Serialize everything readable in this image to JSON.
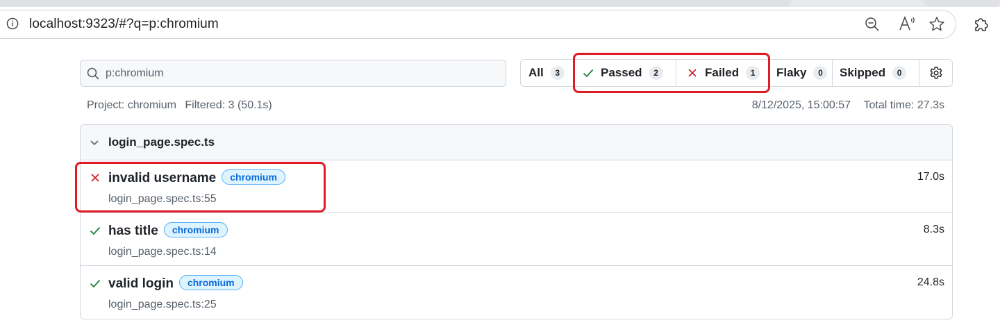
{
  "browser": {
    "url": "localhost:9323/#?q=p:chromium",
    "icons": [
      "info-icon",
      "zoom-out-icon",
      "read-aloud-icon",
      "favorite-star-icon",
      "extensions-icon"
    ]
  },
  "search": {
    "value": "p:chromium",
    "icon": "search-icon"
  },
  "filters": {
    "all": {
      "label": "All",
      "count": "3"
    },
    "passed": {
      "label": "Passed",
      "count": "2",
      "icon": "check-icon"
    },
    "failed": {
      "label": "Failed",
      "count": "1",
      "icon": "x-icon"
    },
    "flaky": {
      "label": "Flaky",
      "count": "0"
    },
    "skipped": {
      "label": "Skipped",
      "count": "0"
    },
    "settings_icon": "gear-icon"
  },
  "summary": {
    "project": "Project: chromium",
    "filtered": "Filtered: 3 (50.1s)",
    "date": "8/12/2025, 15:00:57",
    "total": "Total time: 27.3s"
  },
  "group": {
    "title": "login_page.spec.ts",
    "expanded": true
  },
  "tests": [
    {
      "status": "failed",
      "title": "invalid username",
      "tag": "chromium",
      "location": "login_page.spec.ts:55",
      "duration": "17.0s"
    },
    {
      "status": "passed",
      "title": "has title",
      "tag": "chromium",
      "location": "login_page.spec.ts:14",
      "duration": "8.3s"
    },
    {
      "status": "passed",
      "title": "valid login",
      "tag": "chromium",
      "location": "login_page.spec.ts:25",
      "duration": "24.8s"
    }
  ],
  "colors": {
    "passed": "#1a7f37",
    "failed": "#cf222e",
    "highlight": "#e01b24",
    "tag_bg": "#ddf4ff",
    "tag_text": "#0969da"
  }
}
